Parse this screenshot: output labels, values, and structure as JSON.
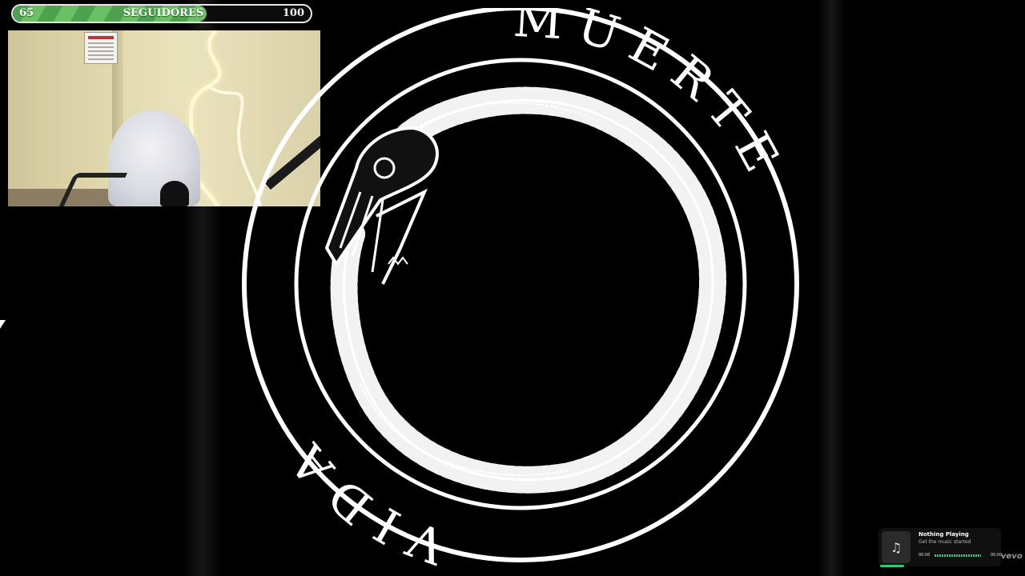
{
  "follower_goal": {
    "current": "65",
    "label": "SEGUIDORES",
    "target": "100",
    "progress_fraction": 0.65,
    "fill_color": "#5cb35a"
  },
  "artwork": {
    "top_word": "MUERTE",
    "bottom_word": "VIDA",
    "subject": "ouroboros-skeleton"
  },
  "music_widget": {
    "title": "Nothing Playing",
    "subtitle": "Get the music started",
    "elapsed": "00:00",
    "duration": "00:00",
    "icon": "music-note-icon",
    "accent_color": "#2ecc71"
  },
  "watermark": "vevo"
}
